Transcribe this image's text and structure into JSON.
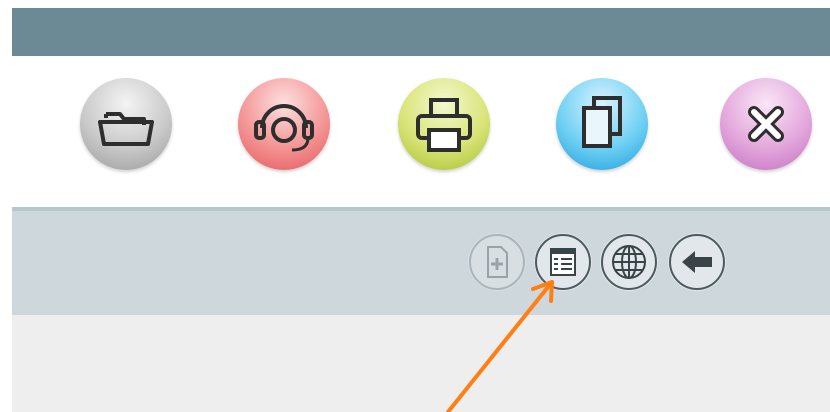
{
  "window": {
    "title": ""
  },
  "toolbar": {
    "buttons": [
      {
        "id": "open",
        "icon": "folder-open-icon",
        "color": "#b5b5b5"
      },
      {
        "id": "support",
        "icon": "headset-icon",
        "color": "#ee7b7f"
      },
      {
        "id": "print",
        "icon": "printer-icon",
        "color": "#c9d85a"
      },
      {
        "id": "copy",
        "icon": "copy-pages-icon",
        "color": "#47bde9"
      },
      {
        "id": "close",
        "icon": "close-x-icon",
        "color": "#d996d3"
      }
    ]
  },
  "subtoolbar": {
    "buttons": [
      {
        "id": "new-document",
        "icon": "file-plus-icon",
        "state": "disabled"
      },
      {
        "id": "form",
        "icon": "form-list-icon",
        "state": "enabled"
      },
      {
        "id": "web",
        "icon": "globe-icon",
        "state": "enabled"
      },
      {
        "id": "back",
        "icon": "arrow-left-icon",
        "state": "enabled"
      }
    ]
  },
  "annotation": {
    "arrow_color": "#ff7f14",
    "target": "form-list-icon"
  },
  "colors": {
    "title_bar": "#6b8a95",
    "subbar": "#cdd7dc",
    "content": "#eeeeee"
  }
}
